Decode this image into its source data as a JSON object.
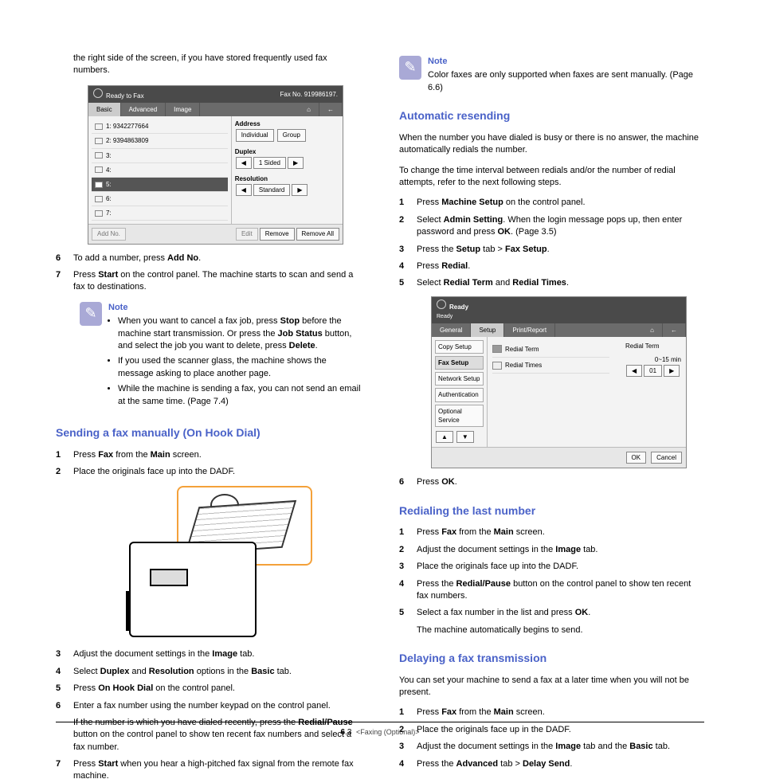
{
  "leftCol": {
    "intro": "the right side of the screen, if you have stored frequently used fax numbers.",
    "screenshot1": {
      "ready": "Ready to Fax",
      "faxNo": "Fax No. 919986197.",
      "tabs": [
        "Basic",
        "Advanced",
        "Image"
      ],
      "rows": [
        {
          "ico": "fax",
          "num": "1: 9342277664"
        },
        {
          "ico": "fax",
          "num": "2: 9394863809"
        },
        {
          "ico": "fax",
          "num": "3:"
        },
        {
          "ico": "fax",
          "num": "4:"
        },
        {
          "ico": "dark",
          "num": "5:"
        },
        {
          "ico": "fax",
          "num": "6:"
        },
        {
          "ico": "fax",
          "num": "7:"
        }
      ],
      "addressLabel": "Address",
      "addressButtons": [
        "Individual",
        "Group"
      ],
      "duplexLabel": "Duplex",
      "duplexValue": "1 Sided",
      "resolutionLabel": "Resolution",
      "resolutionValue": "Standard",
      "footerButtons": [
        "Add No.",
        "Edit",
        "Remove",
        "Remove All"
      ]
    },
    "step6": {
      "n": "6",
      "pre": "To add a number, press ",
      "b": "Add No",
      "post": "."
    },
    "step7": {
      "n": "7",
      "pre": "Press ",
      "b": "Start",
      "post": " on the control panel. The machine starts to scan and send a fax to destinations."
    },
    "note1": {
      "title": "Note",
      "li1a": "When you want to cancel a fax job, press ",
      "li1b": "Stop",
      "li1c": " before the machine start transmission. Or press the ",
      "li1d": "Job Status",
      "li1e": " button, and select the job you want to delete, press ",
      "li1f": "Delete",
      "li1g": ".",
      "li2": "If you used the scanner glass, the machine shows the message asking to place another page.",
      "li3": "While the machine is sending a fax, you can not send an email at the same time. (Page 7.4)"
    },
    "h_onhook": "Sending a fax manually (On Hook Dial)",
    "oh1": {
      "n": "1",
      "a": "Press ",
      "b": "Fax",
      "c": " from the ",
      "d": "Main",
      "e": " screen."
    },
    "oh2": {
      "n": "2",
      "t": "Place the originals face up into the DADF."
    },
    "oh3": {
      "n": "3",
      "a": "Adjust the document settings in the ",
      "b": "Image",
      "c": " tab."
    },
    "oh4": {
      "n": "4",
      "a": "Select ",
      "b": "Duplex",
      "c": " and ",
      "d": "Resolution",
      "e": " options in the ",
      "f": "Basic",
      "g": " tab."
    },
    "oh5": {
      "n": "5",
      "a": "Press ",
      "b": "On Hook Dial",
      "c": " on the control panel."
    },
    "oh6": {
      "n": "6",
      "t": "Enter a fax number using the number keypad on the control panel."
    },
    "oh6sub": {
      "a": "If the number is which you have dialed recently, press the ",
      "b": "Redial/Pause",
      "c": " button on the control panel to show ten recent fax numbers and select a fax number."
    },
    "oh7": {
      "n": "7",
      "a": "Press ",
      "b": "Start",
      "c": " when you hear a high-pitched fax signal from the remote fax machine."
    }
  },
  "rightCol": {
    "noteTop": {
      "title": "Note",
      "text": "Color faxes are only supported when faxes are sent manually. (Page 6.6)"
    },
    "h_auto": "Automatic resending",
    "auto_p1": "When the number you have dialed is busy or there is no answer, the machine automatically redials the number.",
    "auto_p2": "To change the time interval between redials and/or the number of redial attempts, refer to the next following steps.",
    "a1": {
      "n": "1",
      "a": "Press ",
      "b": "Machine Setup",
      "c": " on the control panel."
    },
    "a2": {
      "n": "2",
      "a": "Select ",
      "b": "Admin Setting",
      "c": ". When the login message pops up, then enter password and press ",
      "d": "OK",
      "e": ". (Page 3.5)"
    },
    "a3": {
      "n": "3",
      "a": "Press the ",
      "b": "Setup",
      "c": " tab > ",
      "d": "Fax Setup",
      "e": "."
    },
    "a4": {
      "n": "4",
      "a": "Press ",
      "b": "Redial",
      "c": "."
    },
    "a5": {
      "n": "5",
      "a": "Select ",
      "b": "Redial Term",
      "c": " and ",
      "d": "Redial Times",
      "e": "."
    },
    "screenshot2": {
      "ready": "Ready",
      "readySub": "Ready",
      "tabs": [
        "General",
        "Setup",
        "Print/Report"
      ],
      "side": [
        "Copy Setup",
        "Fax Setup",
        "Network Setup",
        "Authentication",
        "Optional Service"
      ],
      "item1": "Redial Term",
      "item2": "Redial Times",
      "rightLabel": "Redial Term",
      "rightRange": "0~15 min",
      "rightVal": "01",
      "footer": [
        "OK",
        "Cancel"
      ],
      "nav": "▼"
    },
    "a6": {
      "n": "6",
      "a": "Press ",
      "b": "OK",
      "c": "."
    },
    "h_redial": "Redialing the last number",
    "r1": {
      "n": "1",
      "a": "Press ",
      "b": "Fax",
      "c": " from the ",
      "d": "Main",
      "e": " screen."
    },
    "r2": {
      "n": "2",
      "a": "Adjust the document settings in the ",
      "b": "Image",
      "c": " tab."
    },
    "r3": {
      "n": "3",
      "t": "Place the originals face up into the DADF."
    },
    "r4": {
      "n": "4",
      "a": "Press the ",
      "b": "Redial/Pause",
      "c": " button on the control panel to show ten recent fax numbers."
    },
    "r5": {
      "n": "5",
      "a": "Select a fax number in the list and press ",
      "b": "OK",
      "c": "."
    },
    "r5sub": "The machine automatically begins to send.",
    "h_delay": "Delaying a fax transmission",
    "delay_p": "You can set your machine to send a fax at a later time when you will not be present.",
    "d1": {
      "n": "1",
      "a": "Press ",
      "b": "Fax",
      "c": " from the ",
      "d": "Main",
      "e": " screen."
    },
    "d2": {
      "n": "2",
      "t": "Place the originals face up in the DADF."
    },
    "d3": {
      "n": "3",
      "a": "Adjust the document settings in the ",
      "b": "Image",
      "c": " tab and the ",
      "d": "Basic",
      "e": " tab."
    },
    "d4": {
      "n": "4",
      "a": "Press the ",
      "b": "Advanced",
      "c": " tab > ",
      "d": "Delay Send",
      "e": "."
    }
  },
  "footer": {
    "pageNum": "6",
    "pageSub": ".3",
    "chapter": "<Faxing (Optional)>"
  }
}
